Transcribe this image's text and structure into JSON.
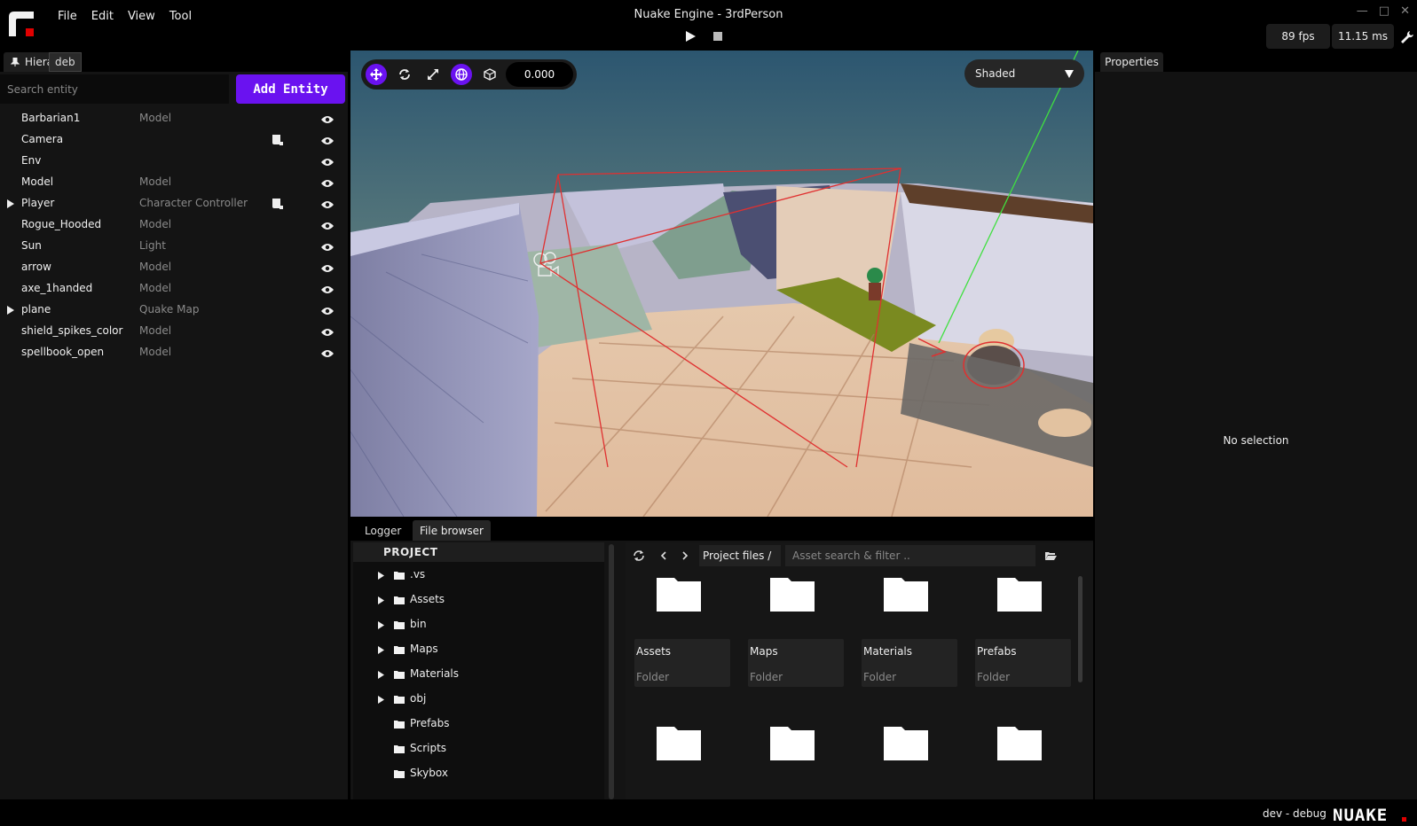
{
  "app": {
    "title": "Nuake Engine - 3rdPerson",
    "menu": [
      "File",
      "Edit",
      "View",
      "Tool"
    ],
    "fps": "89 fps",
    "frame_time": "11.15 ms",
    "accent": "#6a12f0"
  },
  "hierarchy": {
    "tab_label": "Hiera",
    "tooltip": "deb",
    "search_placeholder": "Search entity",
    "add_button": "Add Entity",
    "entities": [
      {
        "name": "Barbarian1",
        "type": "Model",
        "children": false,
        "script": false
      },
      {
        "name": "Camera",
        "type": "",
        "children": false,
        "script": true
      },
      {
        "name": "Env",
        "type": "",
        "children": false,
        "script": false
      },
      {
        "name": "Model",
        "type": "Model",
        "children": false,
        "script": false
      },
      {
        "name": "Player",
        "type": "Character Controller",
        "children": true,
        "script": true
      },
      {
        "name": "Rogue_Hooded",
        "type": "Model",
        "children": false,
        "script": false
      },
      {
        "name": "Sun",
        "type": "Light",
        "children": false,
        "script": false
      },
      {
        "name": "arrow",
        "type": "Model",
        "children": false,
        "script": false
      },
      {
        "name": "axe_1handed",
        "type": "Model",
        "children": false,
        "script": false
      },
      {
        "name": "plane",
        "type": "Quake Map",
        "children": true,
        "script": false
      },
      {
        "name": "shield_spikes_color",
        "type": "Model",
        "children": false,
        "script": false
      },
      {
        "name": "spellbook_open",
        "type": "Model",
        "children": false,
        "script": false
      }
    ]
  },
  "viewport": {
    "snap_value": "0.000",
    "shading_mode": "Shaded",
    "tools": [
      "move-icon",
      "rotate-icon",
      "scale-icon",
      "global-space-icon",
      "local-space-icon"
    ]
  },
  "properties": {
    "tab_label": "Properties",
    "empty_text": "No selection"
  },
  "bottom": {
    "tabs": [
      "Logger",
      "File browser"
    ],
    "tree_header": "PROJECT",
    "tree": [
      {
        "name": ".vs",
        "expandable": true
      },
      {
        "name": "Assets",
        "expandable": true
      },
      {
        "name": "bin",
        "expandable": true
      },
      {
        "name": "Maps",
        "expandable": true
      },
      {
        "name": "Materials",
        "expandable": true
      },
      {
        "name": "obj",
        "expandable": true
      },
      {
        "name": "Prefabs",
        "expandable": false
      },
      {
        "name": "Scripts",
        "expandable": false
      },
      {
        "name": "Skybox",
        "expandable": false
      }
    ],
    "breadcrumb": "Project files /",
    "asset_search_placeholder": "Asset search & filter ..",
    "cards": [
      {
        "name": "Assets",
        "type": "Folder"
      },
      {
        "name": "Maps",
        "type": "Folder"
      },
      {
        "name": "Materials",
        "type": "Folder"
      },
      {
        "name": "Prefabs",
        "type": "Folder"
      }
    ],
    "card_row2_count": 4
  },
  "status": {
    "build": "dev - debug",
    "brand": "NUAKE"
  }
}
